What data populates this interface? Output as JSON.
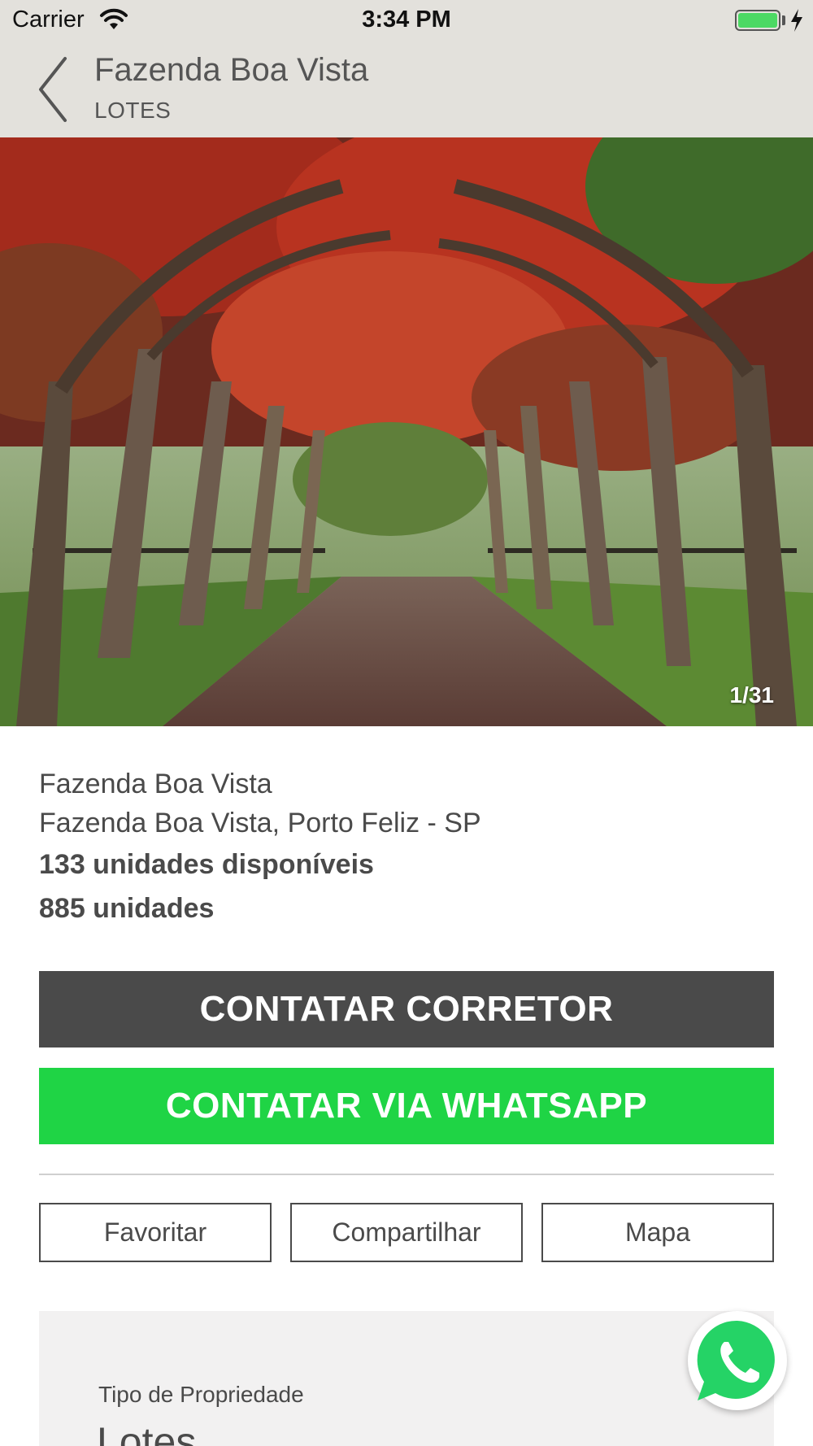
{
  "status_bar": {
    "carrier": "Carrier",
    "time": "3:34 PM"
  },
  "header": {
    "title": "Fazenda Boa Vista",
    "subtitle": "LOTES"
  },
  "gallery": {
    "counter": "1/31"
  },
  "details": {
    "name": "Fazenda Boa Vista",
    "address": "Fazenda Boa Vista, Porto Feliz - SP",
    "available": "133 unidades disponíveis",
    "total": "885 unidades"
  },
  "actions": {
    "contact_broker": "CONTATAR CORRETOR",
    "contact_whatsapp": "CONTATAR VIA WHATSAPP",
    "favorite": "Favoritar",
    "share": "Compartilhar",
    "map": "Mapa"
  },
  "property": {
    "label": "Tipo de Propriedade",
    "value": "Lotes"
  },
  "colors": {
    "header_bg": "#e3e1dc",
    "dark_button": "#4a4a4a",
    "whatsapp_green": "#1fd445",
    "battery": "#4cd964"
  },
  "icons": [
    "wifi-icon",
    "battery-icon",
    "charging-bolt-icon",
    "back-chevron-icon",
    "whatsapp-icon"
  ]
}
